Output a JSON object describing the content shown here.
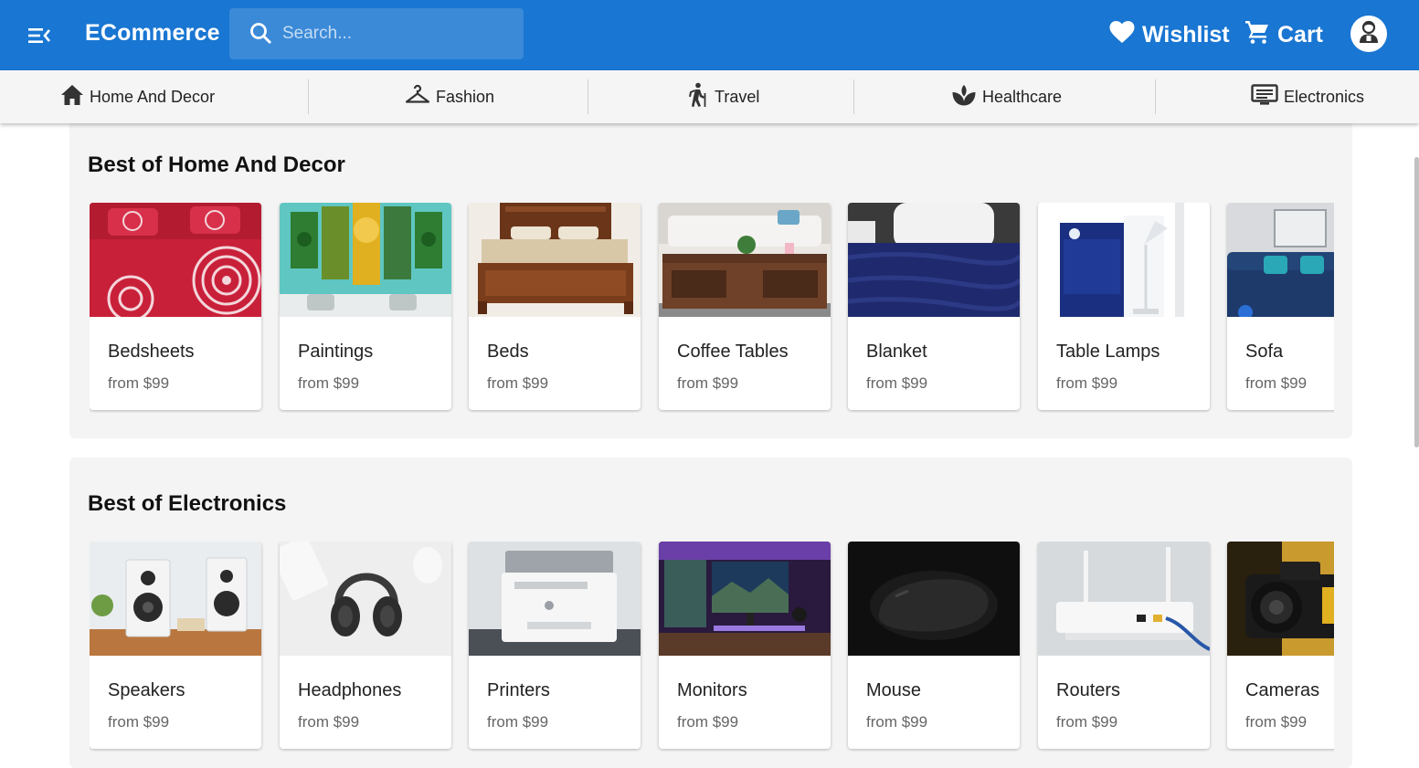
{
  "header": {
    "brand": "ECommerce",
    "search_placeholder": "Search...",
    "wishlist_label": "Wishlist",
    "cart_label": "Cart",
    "accent": "#1976d2"
  },
  "categories": [
    {
      "label": "Home And Decor",
      "icon": "home-icon"
    },
    {
      "label": "Fashion",
      "icon": "hanger-icon"
    },
    {
      "label": "Travel",
      "icon": "hiking-icon"
    },
    {
      "label": "Healthcare",
      "icon": "spa-icon"
    },
    {
      "label": "Electronics",
      "icon": "monitor-icon"
    }
  ],
  "sections": [
    {
      "title": "Best of Home And Decor",
      "items": [
        {
          "name": "Bedsheets",
          "price": "from $99"
        },
        {
          "name": "Paintings",
          "price": "from $99"
        },
        {
          "name": "Beds",
          "price": "from $99"
        },
        {
          "name": "Coffee Tables",
          "price": "from $99"
        },
        {
          "name": "Blanket",
          "price": "from $99"
        },
        {
          "name": "Table Lamps",
          "price": "from $99"
        },
        {
          "name": "Sofa",
          "price": "from $99"
        }
      ]
    },
    {
      "title": "Best of Electronics",
      "items": [
        {
          "name": "Speakers",
          "price": "from $99"
        },
        {
          "name": "Headphones",
          "price": "from $99"
        },
        {
          "name": "Printers",
          "price": "from $99"
        },
        {
          "name": "Monitors",
          "price": "from $99"
        },
        {
          "name": "Mouse",
          "price": "from $99"
        },
        {
          "name": "Routers",
          "price": "from $99"
        },
        {
          "name": "Cameras",
          "price": "from $99"
        }
      ]
    }
  ]
}
